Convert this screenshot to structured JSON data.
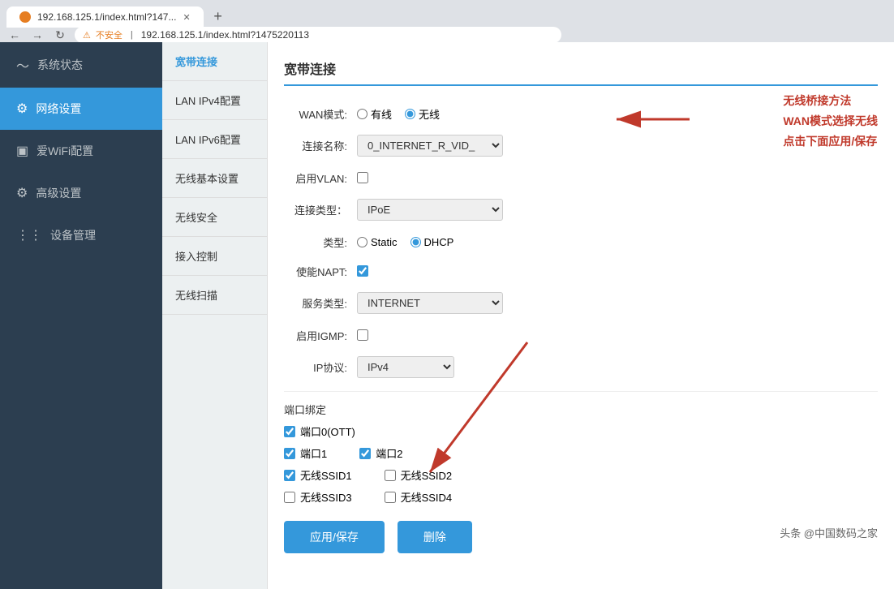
{
  "browser": {
    "tab_label": "192.168.125.1/index.html?147...",
    "address": "192.168.125.1/index.html?1475220113",
    "security_text": "不安全"
  },
  "sidebar": {
    "items": [
      {
        "id": "system-status",
        "label": "系统状态",
        "icon": "〜",
        "active": false
      },
      {
        "id": "network-settings",
        "label": "网络设置",
        "icon": "⚙",
        "active": true
      },
      {
        "id": "wifi-settings",
        "label": "爱WiFi配置",
        "icon": "▣",
        "active": false
      },
      {
        "id": "advanced-settings",
        "label": "高级设置",
        "icon": "⚙",
        "active": false
      },
      {
        "id": "device-management",
        "label": "设备管理",
        "icon": "⋮⋮",
        "active": false
      }
    ]
  },
  "sub_sidebar": {
    "items": [
      {
        "id": "broadband-connect",
        "label": "宽带连接",
        "active_top": true
      },
      {
        "id": "lan-ipv4",
        "label": "LAN IPv4配置",
        "active": false
      },
      {
        "id": "lan-ipv6",
        "label": "LAN IPv6配置",
        "active": false
      },
      {
        "id": "wireless-basic",
        "label": "无线基本设置",
        "active": false
      },
      {
        "id": "wireless-security",
        "label": "无线安全",
        "active": false
      },
      {
        "id": "access-control",
        "label": "接入控制",
        "active": false
      },
      {
        "id": "wireless-scan",
        "label": "无线扫描",
        "active": false
      }
    ]
  },
  "content": {
    "section_title": "宽带连接",
    "form": {
      "wan_mode_label": "WAN模式:",
      "wan_mode_wired": "有线",
      "wan_mode_wireless": "无线",
      "wan_mode_selected": "wireless",
      "connection_name_label": "连接名称:",
      "connection_name_value": "0_INTERNET_R_VID_",
      "enable_vlan_label": "启用VLAN:",
      "connection_type_label": "连接类型：",
      "connection_type_value": "IPoE",
      "type_label": "类型:",
      "type_static": "Static",
      "type_dhcp": "DHCP",
      "type_selected": "dhcp",
      "enable_napt_label": "使能NAPT:",
      "enable_napt_checked": true,
      "service_type_label": "服务类型:",
      "service_type_value": "INTERNET",
      "enable_igmp_label": "启用IGMP:",
      "ip_protocol_label": "IP协议:",
      "ip_protocol_value": "IPv4",
      "port_binding_label": "端口绑定",
      "port0_label": "端口0(OTT)",
      "port0_checked": true,
      "port1_label": "端口1",
      "port1_checked": true,
      "port2_label": "端口2",
      "port2_checked": true,
      "wireless_ssid1_label": "无线SSID1",
      "wireless_ssid1_checked": true,
      "wireless_ssid2_label": "无线SSID2",
      "wireless_ssid2_checked": false,
      "wireless_ssid3_label": "无线SSID3",
      "wireless_ssid3_checked": false,
      "wireless_ssid4_label": "无线SSID4",
      "wireless_ssid4_checked": false
    },
    "buttons": {
      "apply_save": "应用/保存",
      "delete": "删除"
    },
    "annotation": {
      "line1": "无线桥接方法",
      "line2": "WAN模式选择无线",
      "line3": "点击下面应用/保存"
    },
    "watermark": "头条 @中国数码之家"
  }
}
